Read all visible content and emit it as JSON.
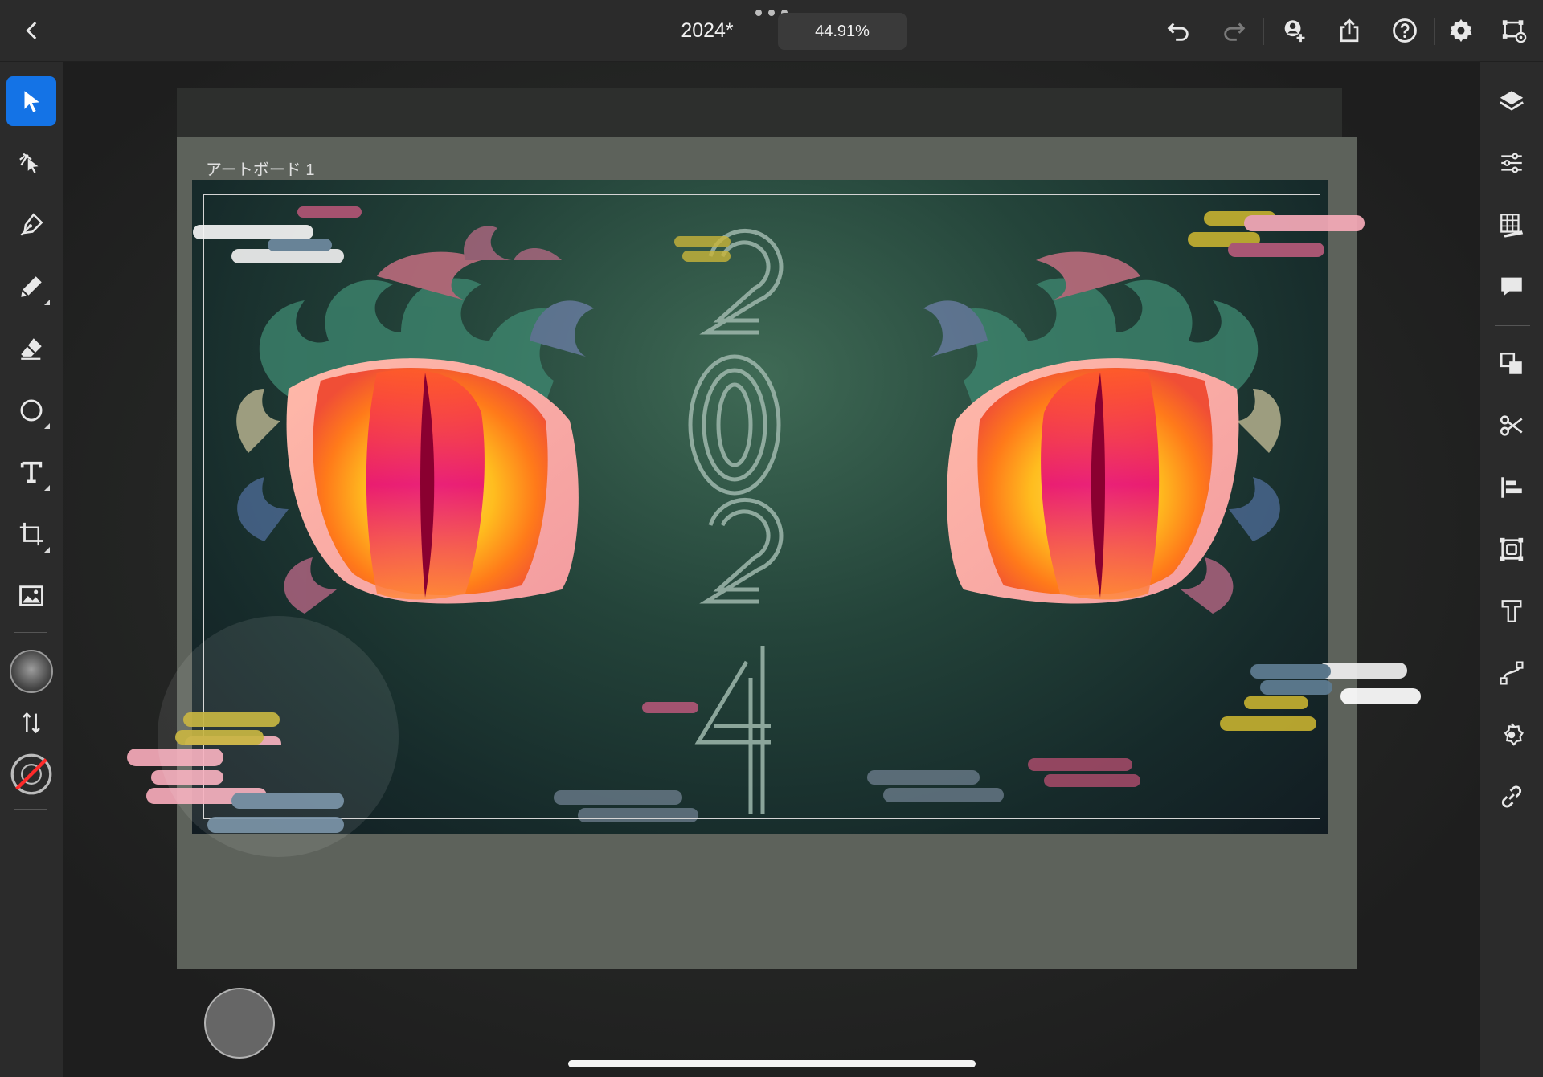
{
  "header": {
    "back_label": "Back",
    "document_title": "2024*",
    "zoom_level": "44.91%",
    "actions": [
      "undo",
      "redo",
      "invite",
      "share",
      "help",
      "settings",
      "artboard-options"
    ]
  },
  "left_toolbar": {
    "tools": [
      "selection",
      "direct-selection",
      "pen",
      "pencil",
      "eraser",
      "ellipse",
      "type",
      "transform",
      "place-image",
      "color-fill",
      "swap",
      "stroke-none"
    ],
    "active_tool": "selection"
  },
  "right_panel": {
    "items": [
      "layers",
      "properties",
      "grid",
      "comments",
      "arrange",
      "scissors",
      "align",
      "repeat-grid",
      "type-options",
      "path",
      "symbol",
      "link"
    ]
  },
  "canvas": {
    "artboard_label": "アートボード 1",
    "artwork_text": "2024"
  },
  "colors": {
    "accent": "#1473e6",
    "toolbar_bg": "#2b2b2b",
    "eye_orange": "#ff8c1a",
    "eye_yellow": "#ffd23c",
    "eye_magenta": "#e6007e",
    "cloud_pink": "#f7b4c4",
    "cloud_white": "#f0f0f0",
    "cloud_olive": "#b8a63a"
  }
}
